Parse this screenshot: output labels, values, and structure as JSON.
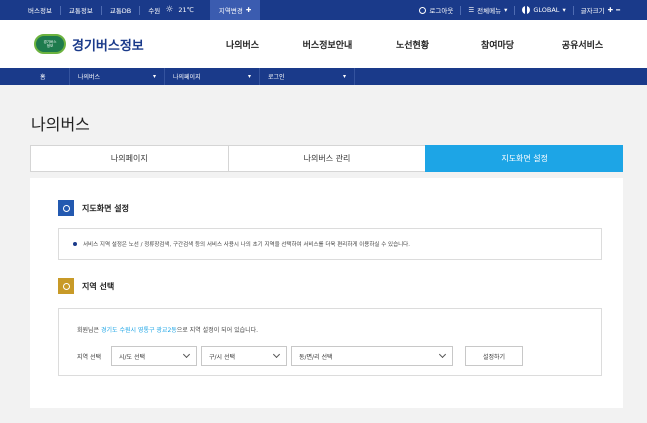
{
  "topbar": {
    "links": [
      "버스정보",
      "교통정보",
      "교통DB",
      "수원"
    ],
    "temperature": "21℃",
    "region_change": "지역변경",
    "logout": "로그아웃",
    "all_menu": "전체메뉴",
    "global": "GLOBAL",
    "font_size": "글자크기"
  },
  "header": {
    "logo_mark_lines": [
      "경기버스",
      "정보"
    ],
    "logo_text": "경기버스정보",
    "gnb": [
      "나의버스",
      "버스정보안내",
      "노선현황",
      "참여마당",
      "공유서비스"
    ]
  },
  "breadcrumb": {
    "home": "홈",
    "level1": "나의버스",
    "level2": "나의페이지",
    "level3": "로그인"
  },
  "page_title": "나의버스",
  "tabs": [
    "나의페이지",
    "나의버스 관리",
    "지도화면 설정"
  ],
  "active_tab": 2,
  "section1": {
    "title": "지도화면 설정",
    "notice": "서비스 지역 설정은 노선 / 정류장검색, 구간검색 등의 서비스 사용시 나의 초기 지역을 선택하여 서비스를 더욱 편리하게 이용하실 수 있습니다."
  },
  "section2": {
    "title": "지역 선택",
    "current_prefix": "회원님은 ",
    "current_region": "경기도 수원시 영통구 광교2동",
    "current_suffix": "으로 지역 설정이 되어 있습니다.",
    "select_label": "지역 선택",
    "select_sido": "시/도 선택",
    "select_sigungu": "구/시 선택",
    "select_dong": "동/면/리 선택",
    "apply_button": "설정하기"
  },
  "colors": {
    "navy": "#1a3a8a",
    "tab_active": "#1da5e6",
    "icon_blue": "#2359b0",
    "icon_gold": "#c89a28"
  }
}
